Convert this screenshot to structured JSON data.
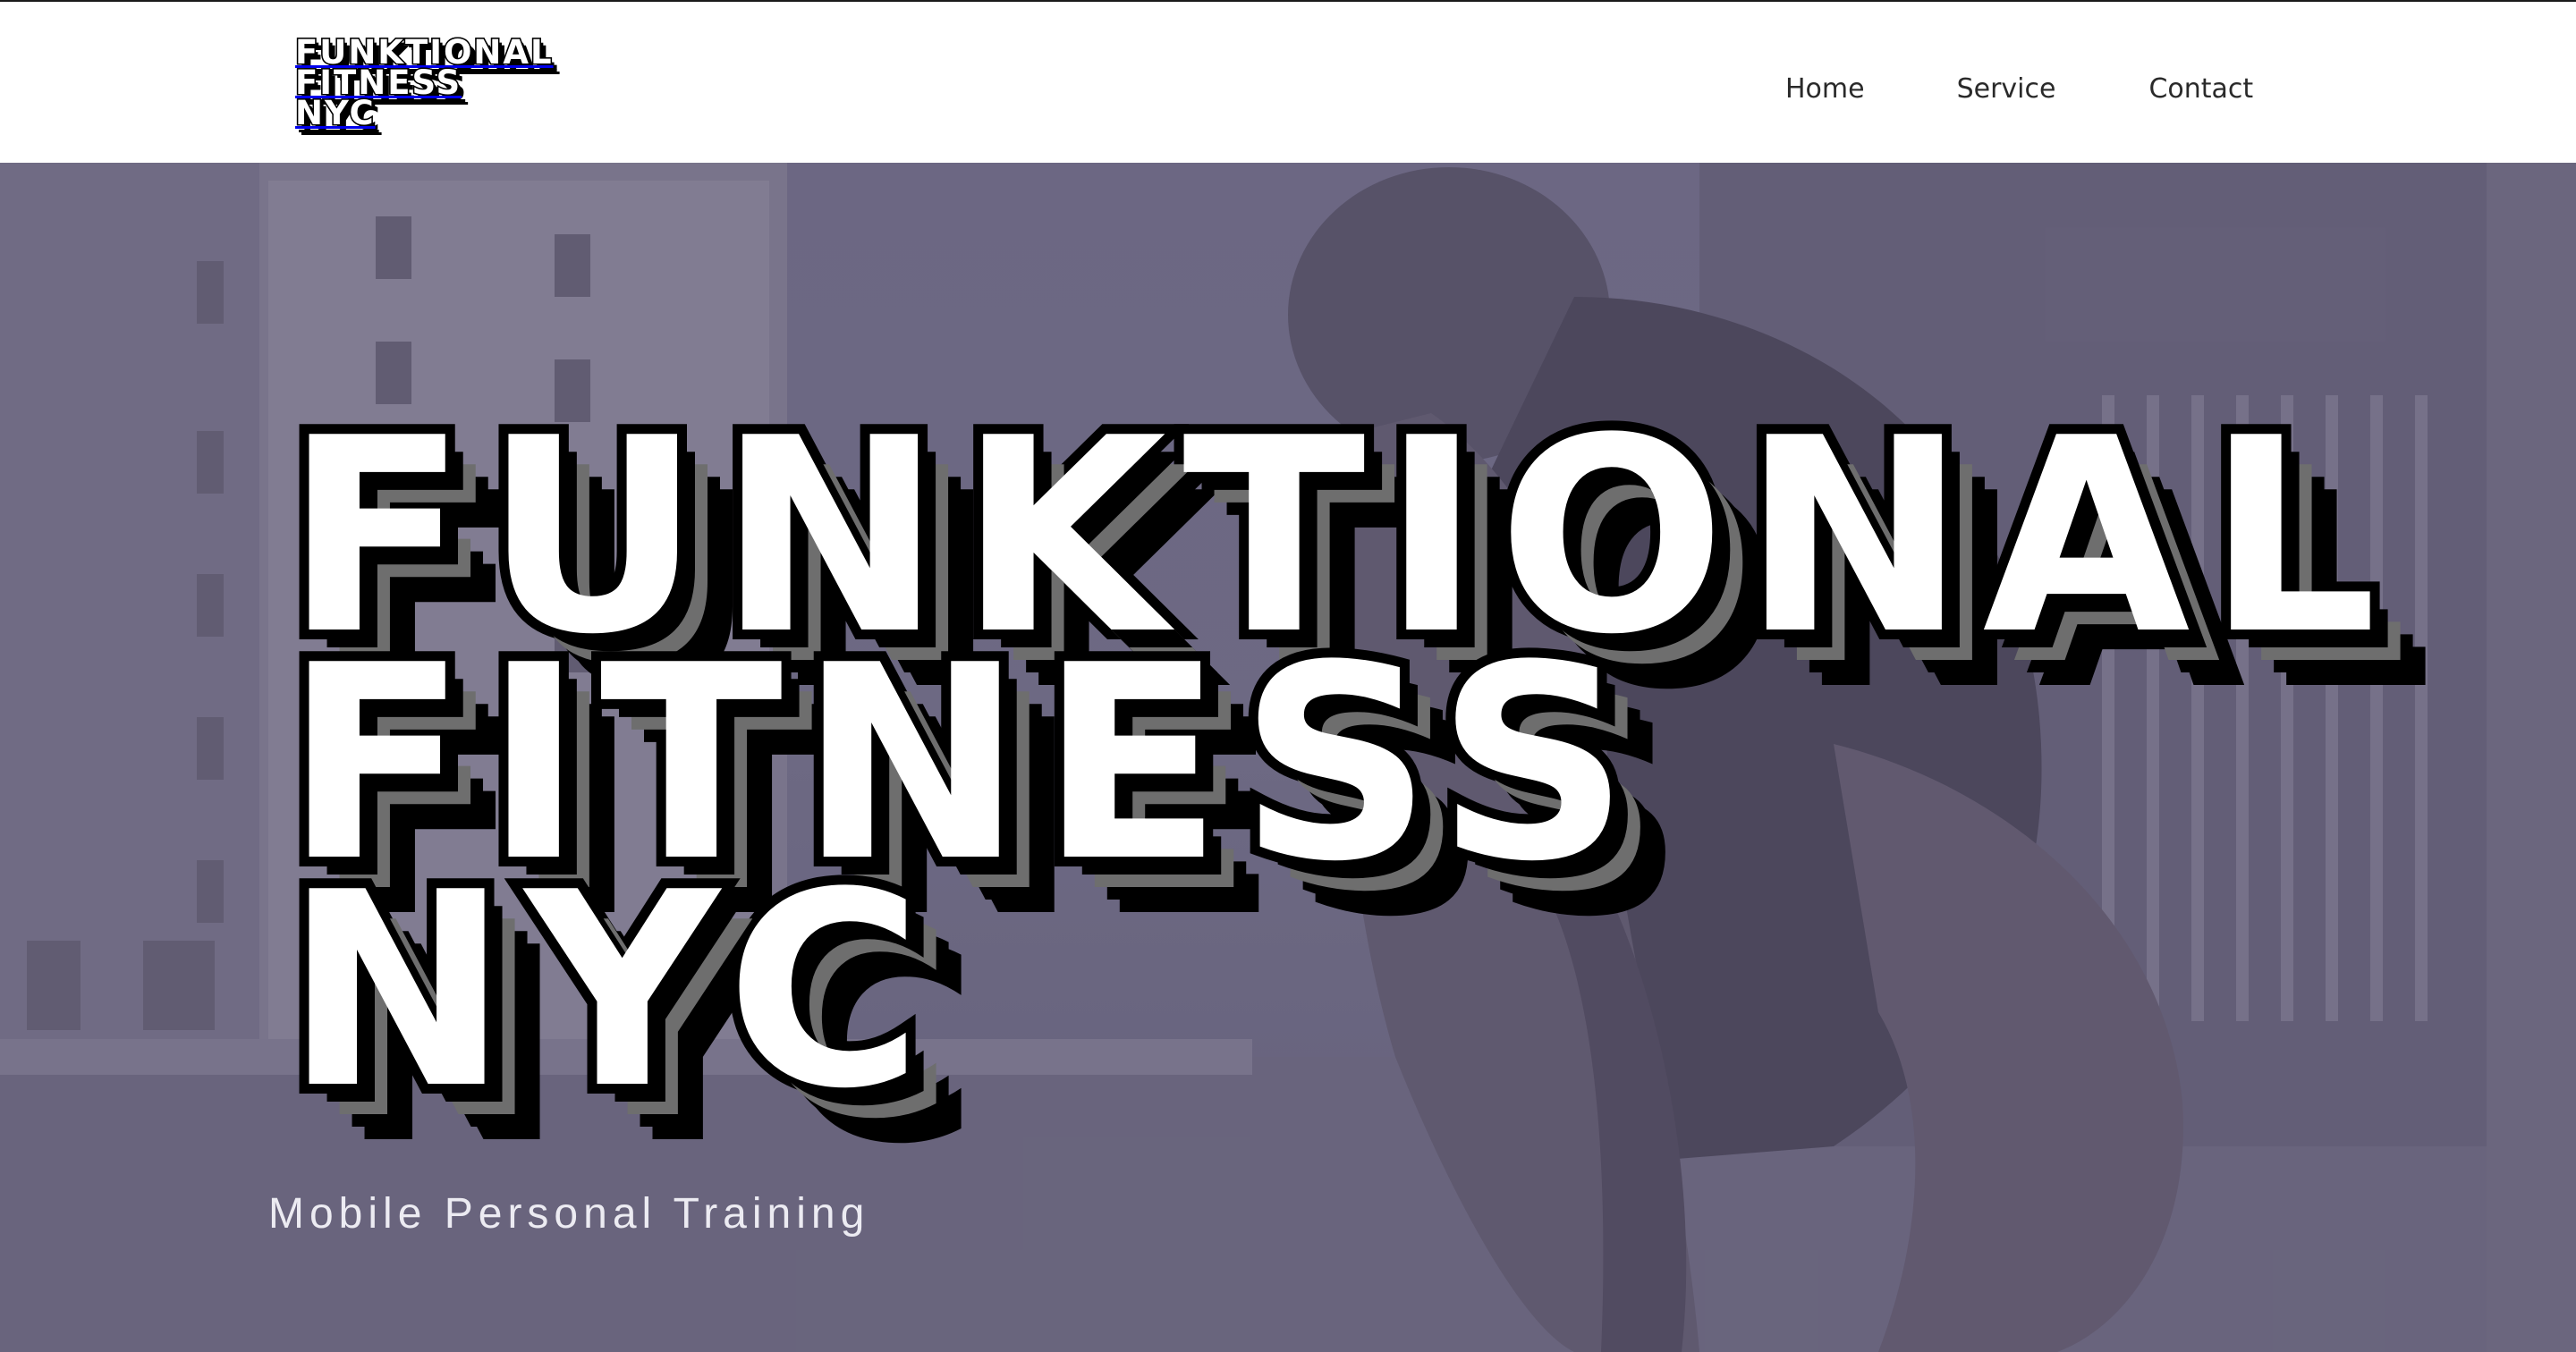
{
  "logo": {
    "lines": [
      "FUNKTIONAL",
      "FITNESS",
      "NYC"
    ]
  },
  "nav": {
    "items": [
      "Home",
      "Service",
      "Contact"
    ]
  },
  "hero": {
    "title_lines": [
      "FUNKTIONAL",
      "FITNESS",
      "NYC"
    ],
    "subtitle": "Mobile Personal Training"
  },
  "colors": {
    "overlay": "#6e688c",
    "title_fill": "#ffffff",
    "title_outline": "#000000",
    "title_shadow": "#6e6e6e",
    "nav_text": "#2a2a2a"
  }
}
